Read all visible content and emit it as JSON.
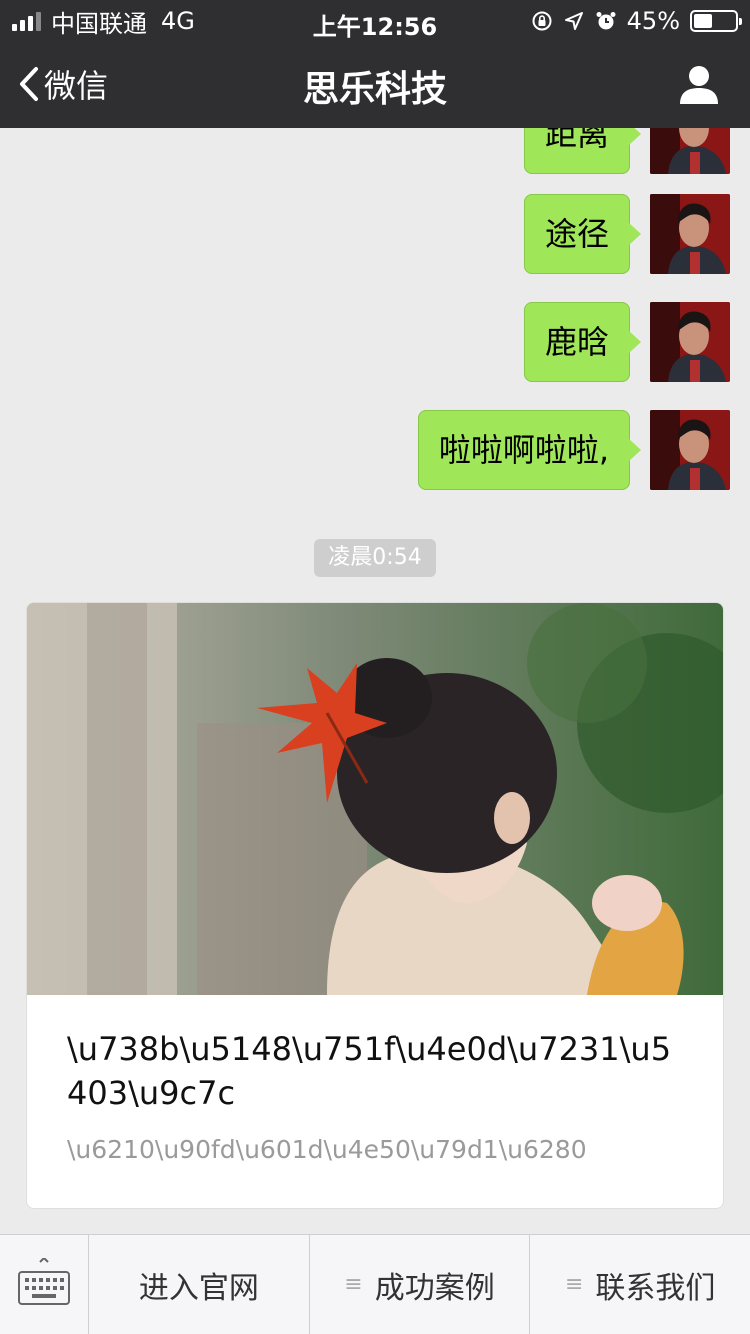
{
  "status_bar": {
    "carrier": "中国联通",
    "network": "4G",
    "time": "上午12:56",
    "battery_text": "45%",
    "battery_level": 0.45
  },
  "nav": {
    "back_label": "微信",
    "title": "思乐科技"
  },
  "messages": [
    {
      "text": "距离"
    },
    {
      "text": "途径"
    },
    {
      "text": "鹿晗"
    },
    {
      "text": "啦啦啊啦啦,"
    }
  ],
  "timestamp": "凌晨0:54",
  "article_card": {
    "title": "\\u738b\\u5148\\u751f\\u4e0d\\u7231\\u5403\\u9c7c",
    "description": "\\u6210\\u90fd\\u601d\\u4e50\\u79d1\\u6280"
  },
  "bottom_menu": {
    "items": [
      {
        "label": "进入官网"
      },
      {
        "label": "成功案例",
        "icon": "≡"
      },
      {
        "label": "联系我们",
        "icon": "≡"
      }
    ]
  },
  "colors": {
    "bar_bg": "#2f2f31",
    "bubble_green": "#9fe658",
    "chat_bg": "#ebebeb"
  }
}
